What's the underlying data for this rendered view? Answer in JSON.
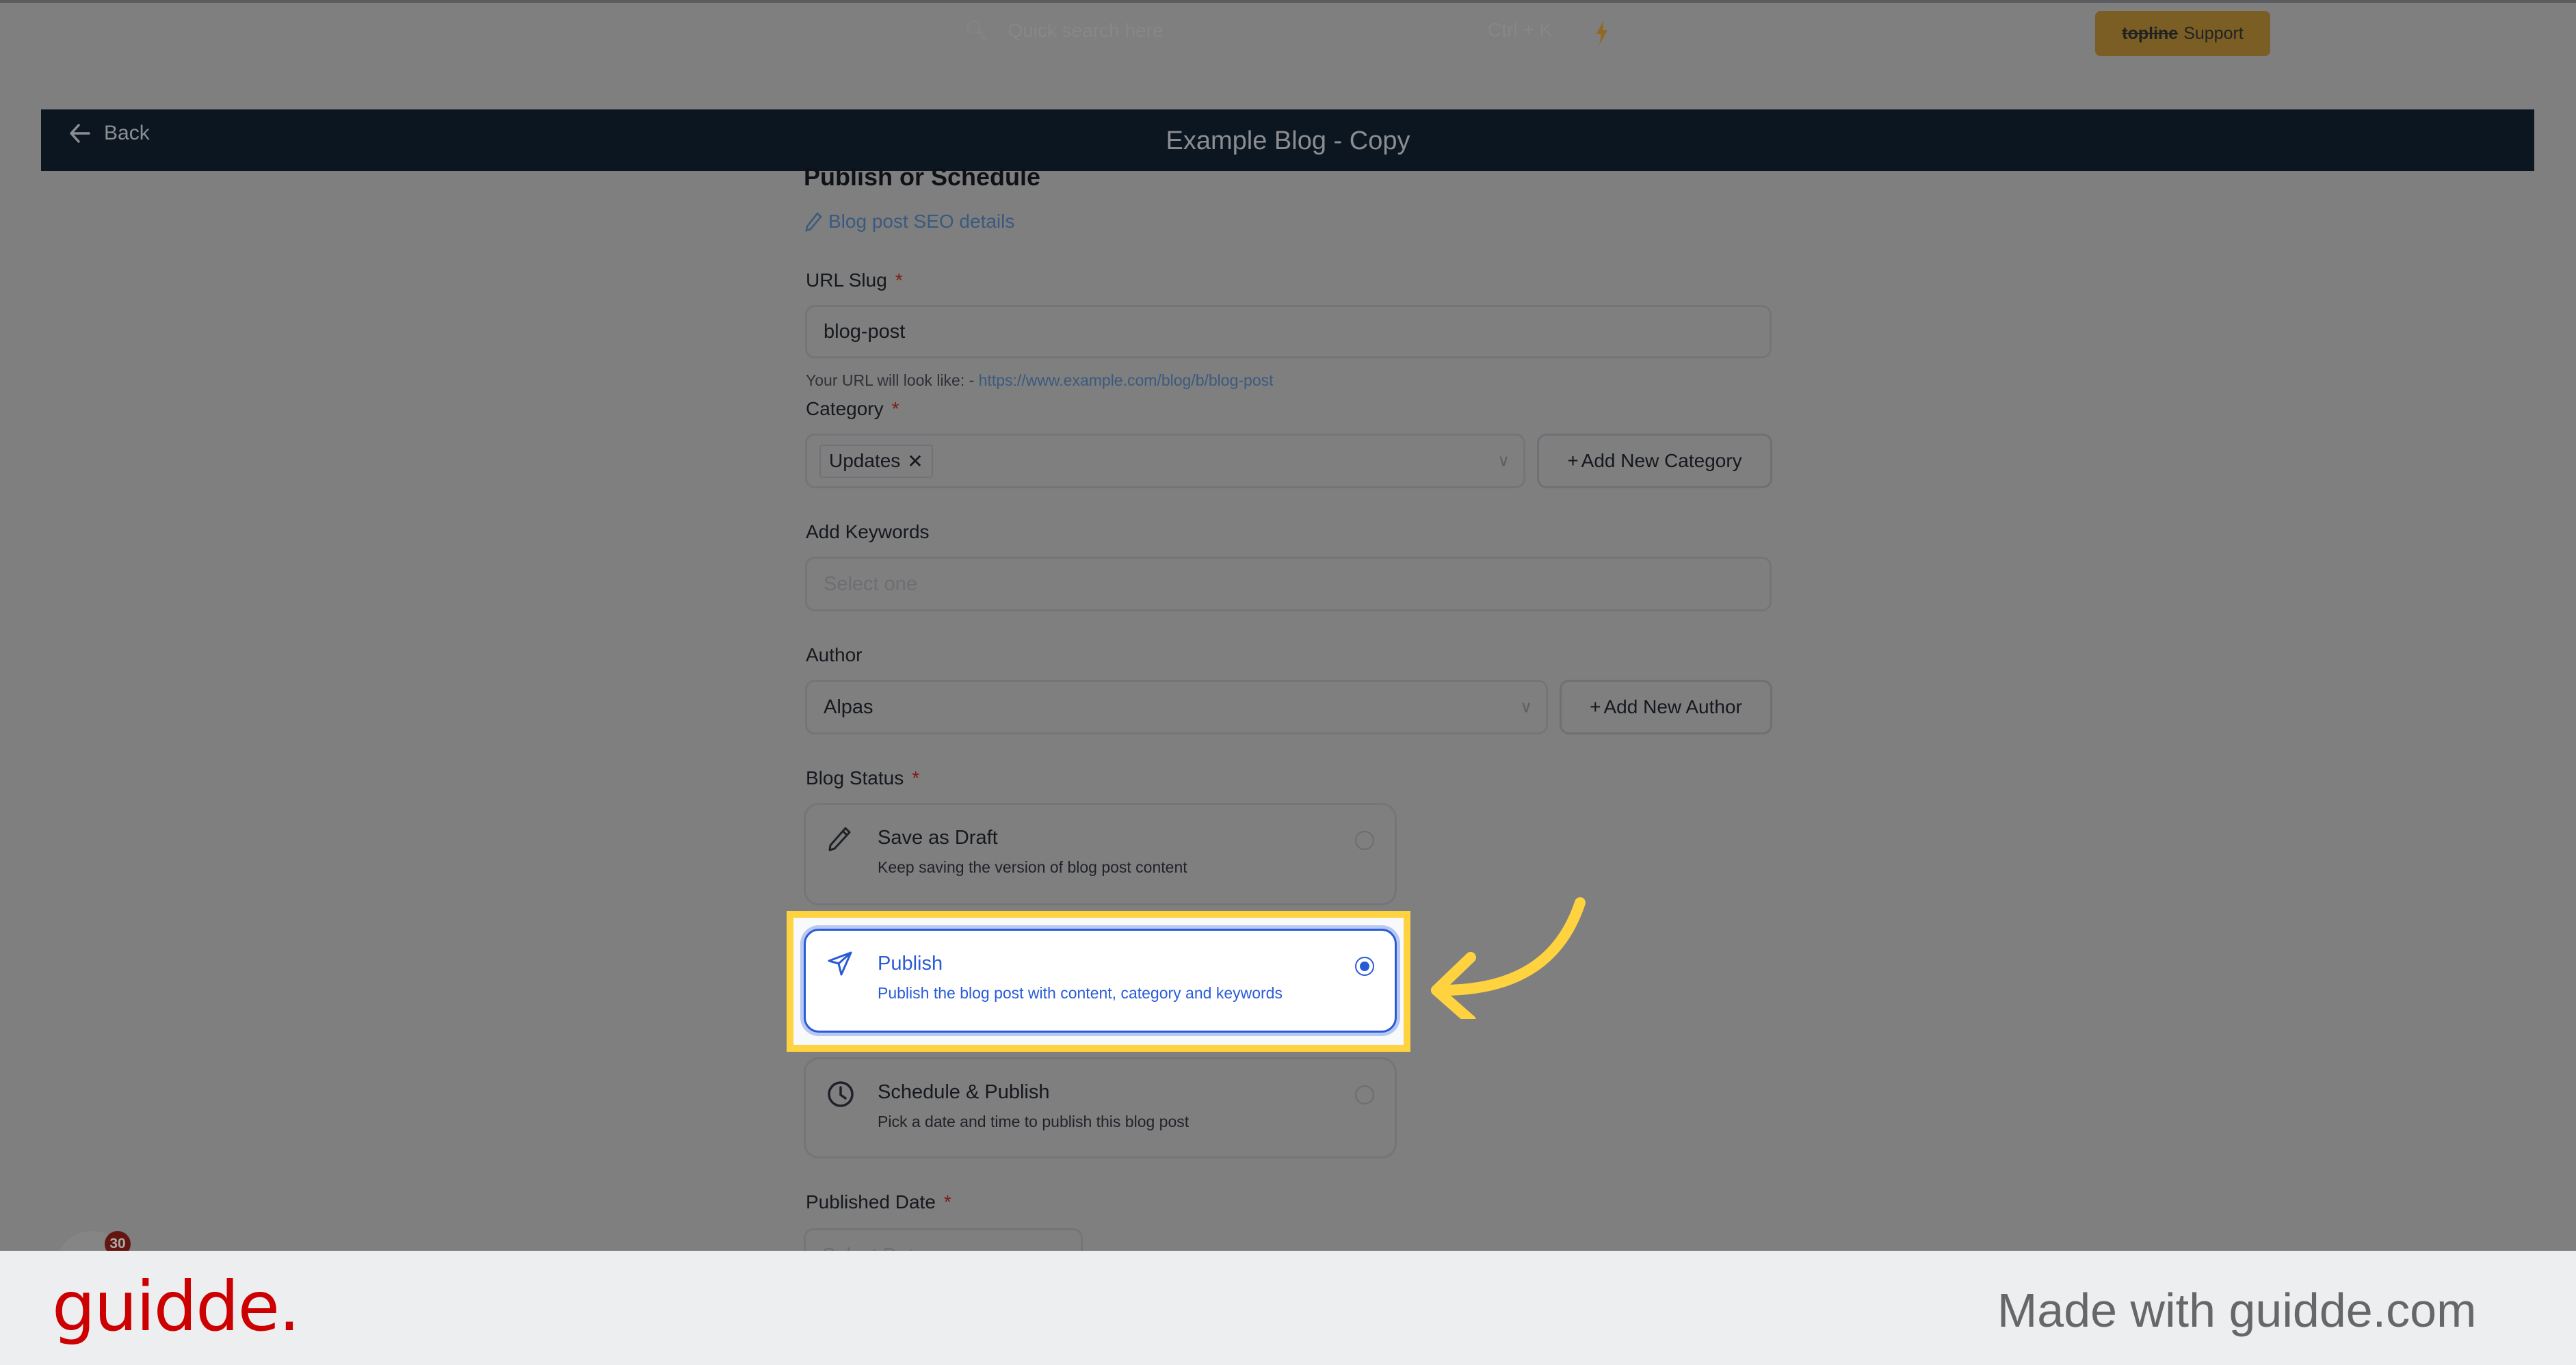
{
  "topbar": {
    "search_placeholder": "Quick search here",
    "search_shortcut": "Ctrl + K",
    "support_brand": "topline",
    "support_label": "Support",
    "colors": {
      "support_bg": "#7a5e24",
      "bolt": "#8f6a1e"
    }
  },
  "header": {
    "back_label": "Back",
    "title": "Example Blog - Copy"
  },
  "form": {
    "section_title": "Publish or Schedule",
    "seo_link": "Blog post SEO details",
    "url_slug": {
      "label": "URL Slug",
      "required": "*",
      "value": "blog-post",
      "hint_prefix": "Your URL will look like: -",
      "hint_url": "https://www.example.com/blog/b/blog-post"
    },
    "category": {
      "label": "Category",
      "required": "*",
      "selected": [
        "Updates"
      ],
      "add_button": "Add New Category"
    },
    "keywords": {
      "label": "Add Keywords",
      "placeholder": "Select one"
    },
    "author": {
      "label": "Author",
      "value": "Alpas",
      "add_button": "Add New Author"
    },
    "blog_status": {
      "label": "Blog Status",
      "required": "*",
      "selected": "Publish",
      "options": [
        {
          "title": "Save as Draft",
          "description": "Keep saving the version of blog post content",
          "icon": "pencil-icon"
        },
        {
          "title": "Publish",
          "description": "Publish the blog post with content, category and keywords",
          "icon": "send-icon"
        },
        {
          "title": "Schedule & Publish",
          "description": "Pick a date and time to publish this blog post",
          "icon": "clock-icon"
        }
      ]
    },
    "published_date": {
      "label": "Published Date",
      "required": "*",
      "placeholder": "Select Date"
    },
    "colors": {
      "accent": "#2a5bd7",
      "required": "#7e1c14",
      "link": "#3a5a7d"
    }
  },
  "notification_badge": "30",
  "annotation": {
    "highlight_color": "#ffd23f",
    "arrow_color": "#ffd23f"
  },
  "footer": {
    "logo": "guidde.",
    "tagline": "Made with guidde.com",
    "colors": {
      "logo": "#cc0000",
      "text": "#666769"
    }
  }
}
